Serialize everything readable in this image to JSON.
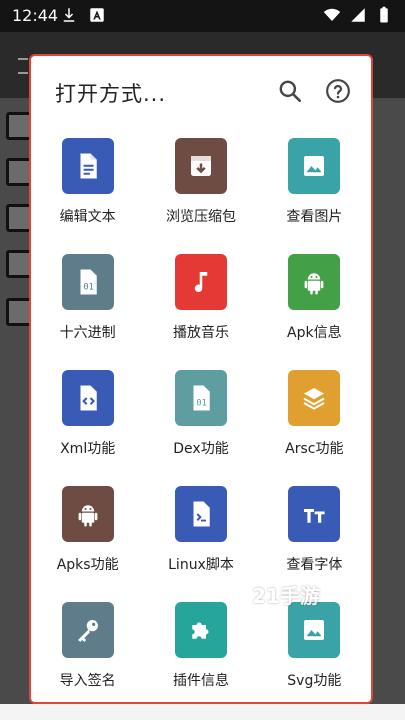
{
  "status_bar": {
    "time": "12:44",
    "left_icons": [
      "download-icon",
      "a-box-icon"
    ],
    "right_icons": [
      "wifi-icon",
      "signal-icon",
      "battery-icon"
    ]
  },
  "dialog": {
    "title": "打开方式...",
    "search_icon": "search-icon",
    "help_icon": "help-icon",
    "border_color": "#e0453a"
  },
  "apps": [
    {
      "label": "编辑文本",
      "icon": "text-file-icon",
      "color": "#3a5bb5"
    },
    {
      "label": "浏览压缩包",
      "icon": "archive-icon",
      "color": "#6f4c43"
    },
    {
      "label": "查看图片",
      "icon": "image-icon",
      "color": "#3aa3a8"
    },
    {
      "label": "十六进制",
      "icon": "hex-file-icon",
      "color": "#5f7c8a"
    },
    {
      "label": "播放音乐",
      "icon": "music-note-icon",
      "color": "#e53935"
    },
    {
      "label": "Apk信息",
      "icon": "android-icon",
      "color": "#43a047"
    },
    {
      "label": "Xml功能",
      "icon": "code-file-icon",
      "color": "#3a5bb5"
    },
    {
      "label": "Dex功能",
      "icon": "dex-file-icon",
      "color": "#5f9ea0"
    },
    {
      "label": "Arsc功能",
      "icon": "layers-icon",
      "color": "#e0a030"
    },
    {
      "label": "Apks功能",
      "icon": "android-icon",
      "color": "#6f4c43"
    },
    {
      "label": "Linux脚本",
      "icon": "terminal-file-icon",
      "color": "#3a5bb5"
    },
    {
      "label": "查看字体",
      "icon": "font-icon",
      "color": "#3a5bb5"
    },
    {
      "label": "导入签名",
      "icon": "key-icon",
      "color": "#5f7c8a"
    },
    {
      "label": "插件信息",
      "icon": "puzzle-icon",
      "color": "#26a69a"
    },
    {
      "label": "Svg功能",
      "icon": "image-icon",
      "color": "#3aa3a8"
    }
  ],
  "watermark": "21手游"
}
